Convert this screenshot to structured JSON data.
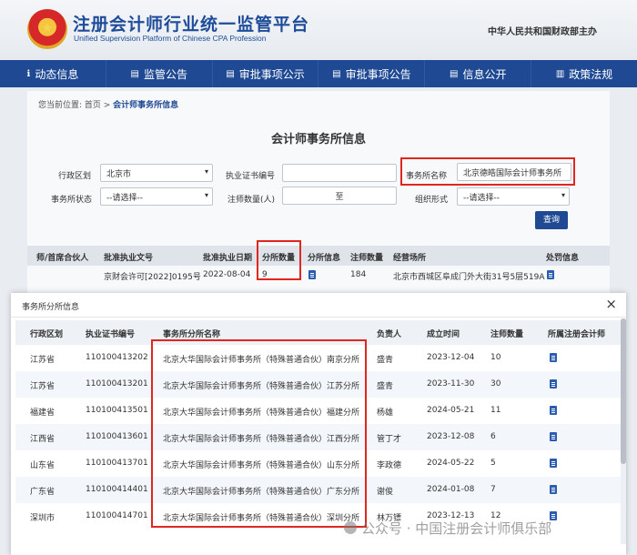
{
  "header": {
    "title": "注册会计师行业统一监管平台",
    "subtitle": "Unified Supervision Platform of Chinese CPA Profession",
    "host": "中华人民共和国财政部主办",
    "emblem_glyph": "★"
  },
  "nav": [
    {
      "label": "动态信息",
      "icon": "ℹ"
    },
    {
      "label": "监管公告",
      "icon": "▤"
    },
    {
      "label": "审批事项公示",
      "icon": "▤"
    },
    {
      "label": "审批事项公告",
      "icon": "▤"
    },
    {
      "label": "信息公开",
      "icon": "▤"
    },
    {
      "label": "政策法规",
      "icon": "▥"
    }
  ],
  "breadcrumb": {
    "prefix": "您当前位置: 首页 > ",
    "current": "会计师事务所信息"
  },
  "page_title": "会计师事务所信息",
  "form": {
    "region_label": "行政区划",
    "region_value": "北京市",
    "cert_label": "执业证书编号",
    "cert_value": "",
    "firm_label": "事务所名称",
    "firm_value": "北京德皓国际会计师事务所",
    "status_label": "事务所状态",
    "status_value": "--请选择--",
    "cpa_count_label": "注师数量(人)",
    "range_sep": "至",
    "org_label": "组织形式",
    "org_value": "--请选择--",
    "query_label": "查询"
  },
  "result": {
    "headers": [
      "师/首席合伙人",
      "批准执业文号",
      "批准执业日期",
      "分所数量",
      "分所信息",
      "注师数量",
      "经营场所",
      "处罚信息"
    ],
    "row": {
      "doc_no": "京财会许可[2022]0195号",
      "date": "2022-08-04",
      "branches": "9",
      "cpas": "184",
      "address": "北京市西城区阜成门外大街31号5层519A"
    }
  },
  "modal": {
    "title": "事务所分所信息",
    "close": "×",
    "headers": [
      "行政区划",
      "执业证书编号",
      "事务所分所名称",
      "负责人",
      "成立时间",
      "注师数量",
      "所属注册会计师"
    ],
    "rows": [
      {
        "region": "江苏省",
        "cert": "110100413202",
        "name": "北京大华国际会计师事务所（特殊普通合伙）南京分所",
        "head": "盛青",
        "date": "2023-12-04",
        "count": "10"
      },
      {
        "region": "江苏省",
        "cert": "110100413201",
        "name": "北京大华国际会计师事务所（特殊普通合伙）江苏分所",
        "head": "盛青",
        "date": "2023-11-30",
        "count": "30"
      },
      {
        "region": "福建省",
        "cert": "110100413501",
        "name": "北京大华国际会计师事务所（特殊普通合伙）福建分所",
        "head": "杨雄",
        "date": "2024-05-21",
        "count": "11"
      },
      {
        "region": "江西省",
        "cert": "110100413601",
        "name": "北京大华国际会计师事务所（特殊普通合伙）江西分所",
        "head": "管丁才",
        "date": "2023-12-08",
        "count": "6"
      },
      {
        "region": "山东省",
        "cert": "110100413701",
        "name": "北京大华国际会计师事务所（特殊普通合伙）山东分所",
        "head": "李政德",
        "date": "2024-05-22",
        "count": "5"
      },
      {
        "region": "广东省",
        "cert": "110100414401",
        "name": "北京大华国际会计师事务所（特殊普通合伙）广东分所",
        "head": "谢俊",
        "date": "2024-01-08",
        "count": "7"
      },
      {
        "region": "深圳市",
        "cert": "110100414701",
        "name": "北京大华国际会计师事务所（特殊普通合伙）深圳分所",
        "head": "林万镖",
        "date": "2023-12-13",
        "count": "12"
      }
    ]
  },
  "watermark": "公众号 · 中国注册会计师俱乐部",
  "colors": {
    "primary": "#1f4a93",
    "highlight": "#e0271f"
  }
}
